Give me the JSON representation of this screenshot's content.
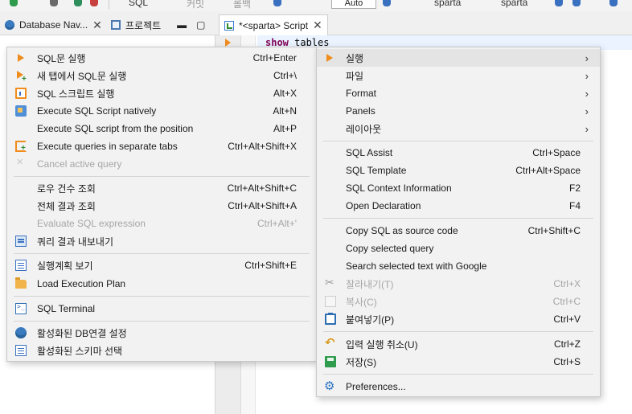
{
  "toolbar": {
    "sql_label": "SQL",
    "commit_label": "커밋",
    "rollback_label": "롤백",
    "transaction_mode": "Auto",
    "datasource_1": "sparta",
    "datasource_2": "sparta"
  },
  "tabs": {
    "db_navigator": "Database Nav...",
    "projects": "프로젝트",
    "script": "*<sparta> Script"
  },
  "editor": {
    "code_keyword": "show",
    "code_rest": " tables"
  },
  "left_menu": {
    "items": [
      {
        "label": "SQL문 실행",
        "shortcut": "Ctrl+Enter",
        "icon": "run-play-icon",
        "disabled": false
      },
      {
        "label": "새 탭에서 SQL문 실행",
        "shortcut": "Ctrl+\\",
        "icon": "run-new-tab-icon",
        "disabled": false
      },
      {
        "label": "SQL 스크립트 실행",
        "shortcut": "Alt+X",
        "icon": "script-run-icon",
        "disabled": false
      },
      {
        "label": "Execute SQL Script natively",
        "shortcut": "Alt+N",
        "icon": "native-script-icon",
        "disabled": false
      },
      {
        "label": "Execute SQL script from the position",
        "shortcut": "Alt+P",
        "icon": "",
        "disabled": false
      },
      {
        "label": "Execute queries in separate tabs",
        "shortcut": "Ctrl+Alt+Shift+X",
        "icon": "separate-tabs-icon",
        "disabled": false
      },
      {
        "label": "Cancel active query",
        "shortcut": "",
        "icon": "cancel-icon",
        "disabled": true
      },
      {
        "label": "로우 건수 조회",
        "shortcut": "Ctrl+Alt+Shift+C",
        "icon": "",
        "disabled": false
      },
      {
        "label": "전체 결과 조회",
        "shortcut": "Ctrl+Alt+Shift+A",
        "icon": "",
        "disabled": false
      },
      {
        "label": "Evaluate SQL expression",
        "shortcut": "Ctrl+Alt+'",
        "icon": "",
        "disabled": true
      },
      {
        "label": "쿼리 결과 내보내기",
        "shortcut": "",
        "icon": "export-icon",
        "disabled": false
      },
      {
        "label": "실행계획 보기",
        "shortcut": "Ctrl+Shift+E",
        "icon": "execution-plan-icon",
        "disabled": false
      },
      {
        "label": "Load Execution Plan",
        "shortcut": "",
        "icon": "folder-icon",
        "disabled": false
      },
      {
        "label": "SQL Terminal",
        "shortcut": "",
        "icon": "terminal-icon",
        "disabled": false
      },
      {
        "label": "활성화된 DB연결 설정",
        "shortcut": "",
        "icon": "database-icon",
        "disabled": false
      },
      {
        "label": "활성화된 스키마 선택",
        "shortcut": "",
        "icon": "schema-icon",
        "disabled": false
      }
    ]
  },
  "right_menu": {
    "items": [
      {
        "label": "실행",
        "shortcut": "",
        "submenu": true,
        "disabled": false
      },
      {
        "label": "파일",
        "shortcut": "",
        "submenu": true,
        "disabled": false
      },
      {
        "label": "Format",
        "shortcut": "",
        "submenu": true,
        "disabled": false
      },
      {
        "label": "Panels",
        "shortcut": "",
        "submenu": true,
        "disabled": false
      },
      {
        "label": "레이아웃",
        "shortcut": "",
        "submenu": true,
        "disabled": false
      },
      {
        "label": "SQL Assist",
        "shortcut": "Ctrl+Space",
        "submenu": false,
        "disabled": false
      },
      {
        "label": "SQL Template",
        "shortcut": "Ctrl+Alt+Space",
        "submenu": false,
        "disabled": false
      },
      {
        "label": "SQL Context Information",
        "shortcut": "F2",
        "submenu": false,
        "disabled": false
      },
      {
        "label": "Open Declaration",
        "shortcut": "F4",
        "submenu": false,
        "disabled": false
      },
      {
        "label": "Copy SQL as source code",
        "shortcut": "Ctrl+Shift+C",
        "submenu": false,
        "disabled": false
      },
      {
        "label": "Copy selected query",
        "shortcut": "",
        "submenu": false,
        "disabled": false
      },
      {
        "label": "Search selected text with Google",
        "shortcut": "",
        "submenu": false,
        "disabled": false
      },
      {
        "label": "잘라내기(T)",
        "shortcut": "Ctrl+X",
        "submenu": false,
        "disabled": true
      },
      {
        "label": "복사(C)",
        "shortcut": "Ctrl+C",
        "submenu": false,
        "disabled": true
      },
      {
        "label": "붙여넣기(P)",
        "shortcut": "Ctrl+V",
        "submenu": false,
        "disabled": false
      },
      {
        "label": "입력 실행 취소(U)",
        "shortcut": "Ctrl+Z",
        "submenu": false,
        "disabled": false
      },
      {
        "label": "저장(S)",
        "shortcut": "Ctrl+S",
        "submenu": false,
        "disabled": false
      },
      {
        "label": "Preferences...",
        "shortcut": "",
        "submenu": false,
        "disabled": false
      }
    ]
  },
  "colors": {
    "accent_orange": "#f08c1c",
    "accent_blue": "#3a70c0",
    "menu_bg": "#f2f2f2",
    "menu_highlight": "#e4e4e4",
    "disabled_text": "#a6a6a6"
  }
}
